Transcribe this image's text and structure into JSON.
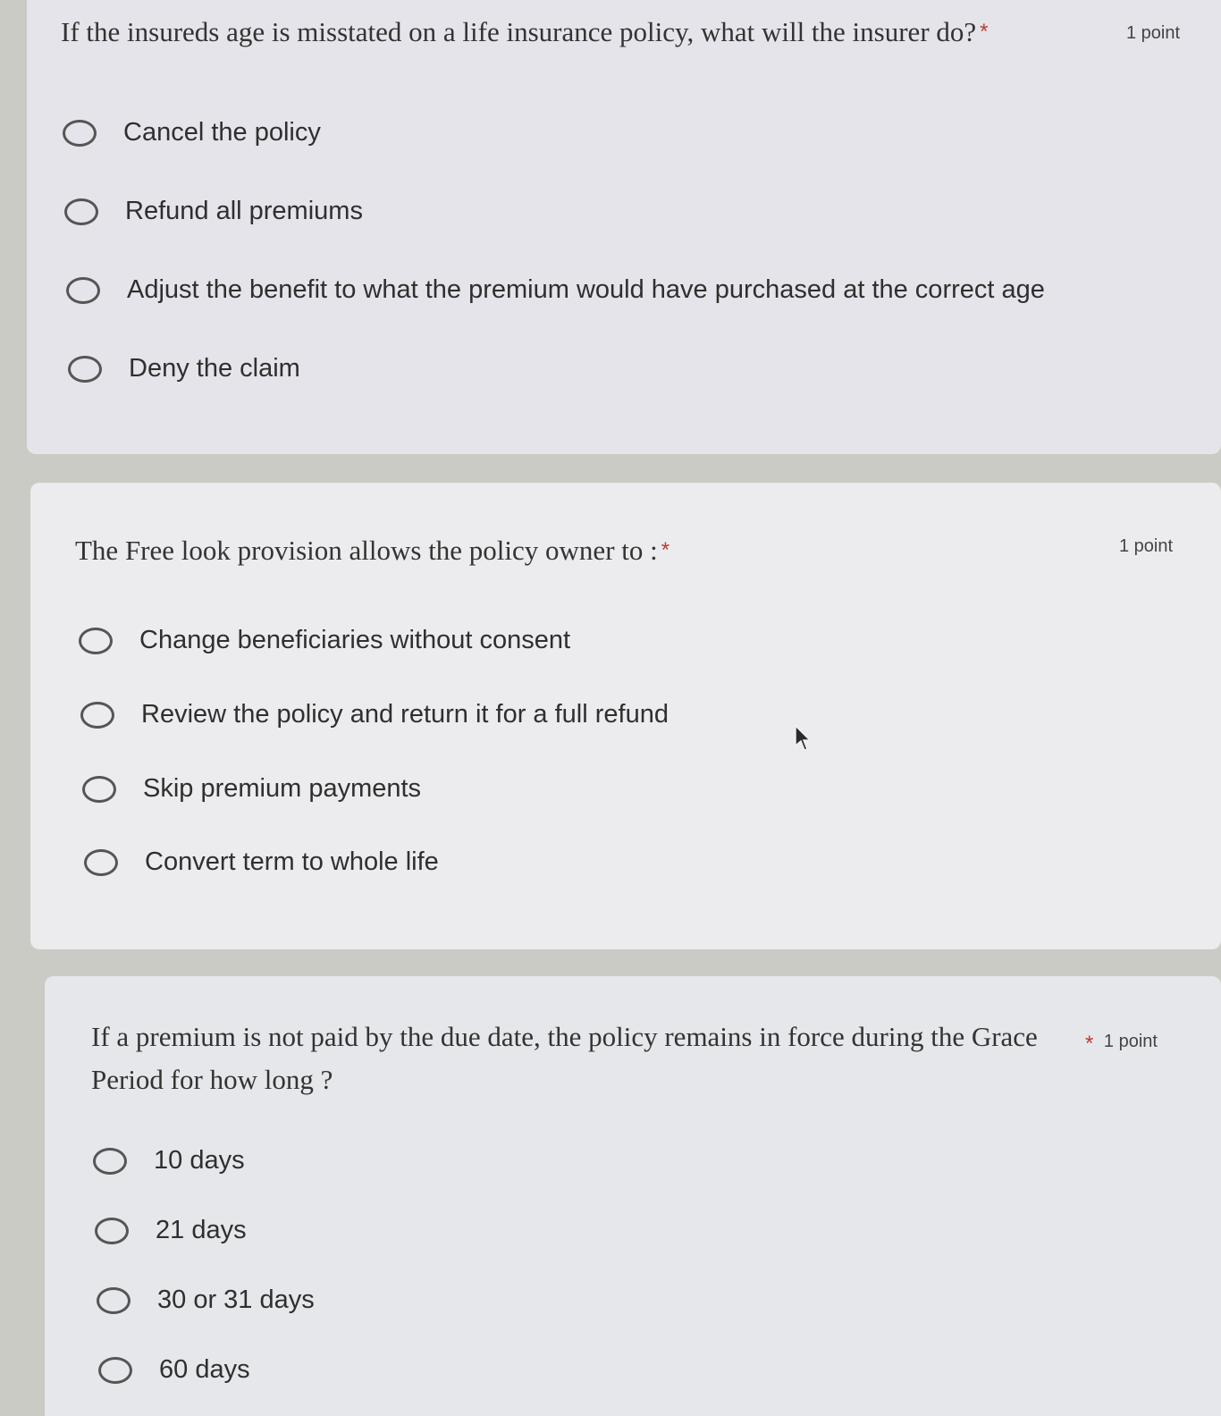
{
  "questions": [
    {
      "text": "If the insureds age is misstated on a life insurance policy, what will the insurer do?",
      "required": "*",
      "points": "1 point",
      "options": [
        "Cancel the policy",
        "Refund all premiums",
        "Adjust the benefit to what the premium would have purchased at the correct age",
        "Deny the claim"
      ]
    },
    {
      "text": "The Free look provision allows the policy owner to :",
      "required": "*",
      "points": "1 point",
      "options": [
        "Change beneficiaries without consent",
        "Review the policy and return it for a full refund",
        "Skip premium payments",
        "Convert term to whole life"
      ]
    },
    {
      "text_line1": "If a premium is not paid by the due date, the policy remains in force during the Grace",
      "text_line2": "Period for how long ?",
      "required": "*",
      "points": "1 point",
      "options": [
        "10 days",
        "21 days",
        "30 or 31 days",
        "60 days"
      ]
    }
  ]
}
